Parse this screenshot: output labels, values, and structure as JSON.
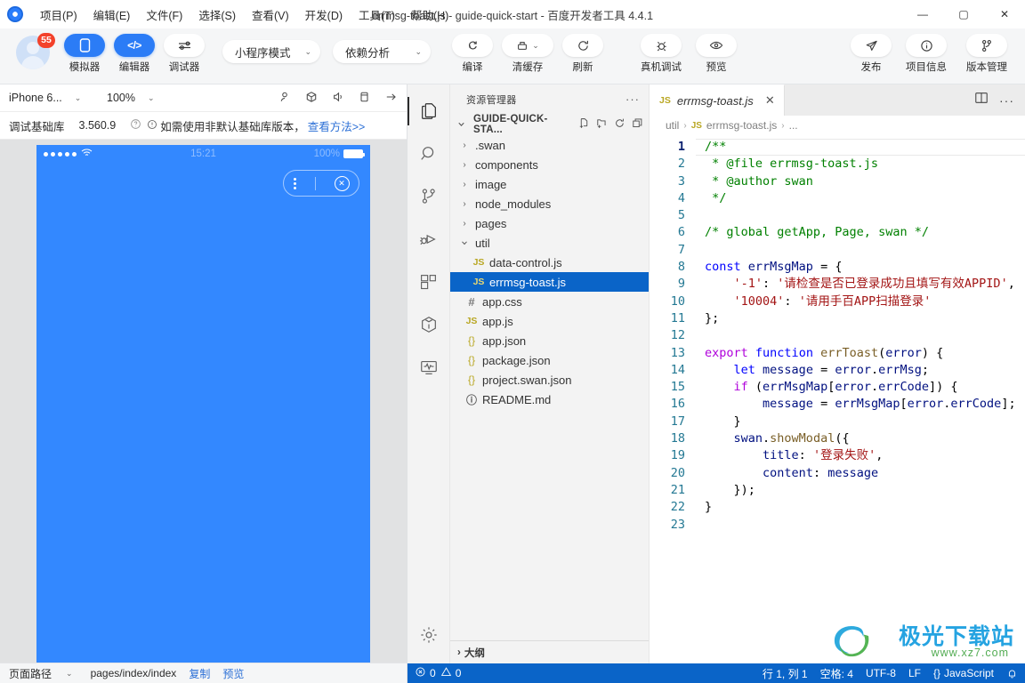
{
  "window": {
    "title": "errmsg-toast.js - guide-quick-start - 百度开发者工具 4.4.1",
    "minimize": "—",
    "maximize": "▢",
    "close": "✕"
  },
  "menubar": {
    "logo": "baidu-logo-icon",
    "items": [
      {
        "label": "项目(P)"
      },
      {
        "label": "编辑(E)"
      },
      {
        "label": "文件(F)"
      },
      {
        "label": "选择(S)"
      },
      {
        "label": "查看(V)"
      },
      {
        "label": "开发(D)"
      },
      {
        "label": "工具(T)"
      },
      {
        "label": "帮助(H)"
      }
    ]
  },
  "toolbar": {
    "avatar_badge": "55",
    "left_buttons": [
      {
        "label": "模拟器",
        "icon": "phone-icon",
        "glyph": "▯",
        "active": true
      },
      {
        "label": "编辑器",
        "icon": "code-icon",
        "glyph": "</>",
        "active": true
      },
      {
        "label": "调试器",
        "icon": "debug-slider-icon",
        "glyph": "⇌",
        "active": false
      }
    ],
    "mode_select": {
      "value": "小程序模式",
      "chevron": "⌄"
    },
    "analysis_select": {
      "value": "依赖分析",
      "chevron": "⌄"
    },
    "mid_buttons": [
      {
        "label": "编译",
        "icon": "compile-refresh-icon",
        "glyph": "↻"
      },
      {
        "label": "清缓存",
        "icon": "clear-cache-icon",
        "glyph": "⎙",
        "chevron": "⌄"
      },
      {
        "label": "刷新",
        "icon": "reload-icon",
        "glyph": "⟳"
      },
      {
        "label": "真机调试",
        "icon": "bug-device-icon",
        "glyph": "✸"
      },
      {
        "label": "预览",
        "icon": "eye-icon",
        "glyph": "◉"
      }
    ],
    "right_buttons": [
      {
        "label": "发布",
        "icon": "send-icon",
        "glyph": "➤"
      },
      {
        "label": "项目信息",
        "icon": "info-icon",
        "glyph": "ⓘ"
      },
      {
        "label": "版本管理",
        "icon": "branch-icon",
        "glyph": "⑂"
      }
    ]
  },
  "simulator": {
    "device": {
      "value": "iPhone 6...",
      "chevron": "⌄"
    },
    "zoom": {
      "value": "100%",
      "chevron": "⌄"
    },
    "right_icons": [
      {
        "name": "account-icon",
        "glyph": "⚲"
      },
      {
        "name": "cube-icon",
        "glyph": "⬡"
      },
      {
        "name": "volume-icon",
        "glyph": "◁"
      },
      {
        "name": "device-rotate-icon",
        "glyph": "▯"
      },
      {
        "name": "arrow-right-icon",
        "glyph": "→"
      }
    ],
    "baselib": {
      "label": "调试基础库",
      "version": "3.560.9",
      "help_icon": "question-circle-icon",
      "warn_icon": "exclamation-circle-icon",
      "notice": "如需使用非默认基础库版本，",
      "link": "查看方法>>"
    },
    "phone": {
      "signal_dots": 5,
      "wifi_icon": "wifi-icon",
      "time": "15:21",
      "battery_percent": "100%",
      "battery_icon": "battery-full-icon",
      "capsule": {
        "menu_icon": "kebab-menu-icon",
        "close_icon": "close-circle-icon"
      },
      "screen_color": "#3388ff"
    },
    "footer": {
      "path_label": "页面路径",
      "chevron": "⌄",
      "path_value": "pages/index/index",
      "copy": "复制",
      "preview": "预览"
    }
  },
  "activitybar": {
    "items": [
      {
        "name": "explorer-icon",
        "glyph": "🗐",
        "active": true
      },
      {
        "name": "search-icon",
        "glyph": "⌕",
        "active": false
      },
      {
        "name": "source-control-icon",
        "glyph": "⑂",
        "active": false
      },
      {
        "name": "run-debug-icon",
        "glyph": "▷",
        "active": false
      },
      {
        "name": "extensions-icon",
        "glyph": "⊞",
        "active": false
      },
      {
        "name": "package-icon",
        "glyph": "⬡",
        "active": false
      },
      {
        "name": "performance-icon",
        "glyph": "📈",
        "active": false
      }
    ],
    "bottom": {
      "name": "settings-gear-icon",
      "glyph": "⚙"
    }
  },
  "explorer": {
    "title": "资源管理器",
    "more": "···",
    "root": {
      "chevron": "⌄",
      "name": "GUIDE-QUICK-STA...",
      "actions": [
        {
          "name": "new-file-icon",
          "glyph": "🗋"
        },
        {
          "name": "new-folder-icon",
          "glyph": "🗀"
        },
        {
          "name": "refresh-icon",
          "glyph": "↻"
        },
        {
          "name": "collapse-all-icon",
          "glyph": "⊟"
        }
      ]
    },
    "tree": [
      {
        "label": ".swan",
        "type": "folder",
        "expanded": false,
        "depth": 1
      },
      {
        "label": "components",
        "type": "folder",
        "expanded": false,
        "depth": 1
      },
      {
        "label": "image",
        "type": "folder",
        "expanded": false,
        "depth": 1
      },
      {
        "label": "node_modules",
        "type": "folder",
        "expanded": false,
        "depth": 1
      },
      {
        "label": "pages",
        "type": "folder",
        "expanded": false,
        "depth": 1
      },
      {
        "label": "util",
        "type": "folder",
        "expanded": true,
        "depth": 1
      },
      {
        "label": "data-control.js",
        "type": "js",
        "depth": 2,
        "icon": "JS"
      },
      {
        "label": "errmsg-toast.js",
        "type": "js",
        "depth": 2,
        "icon": "JS",
        "selected": true
      },
      {
        "label": "app.css",
        "type": "css",
        "depth": 1,
        "icon": "#"
      },
      {
        "label": "app.js",
        "type": "js",
        "depth": 1,
        "icon": "JS"
      },
      {
        "label": "app.json",
        "type": "json",
        "depth": 1,
        "icon": "{}"
      },
      {
        "label": "package.json",
        "type": "json",
        "depth": 1,
        "icon": "{}"
      },
      {
        "label": "project.swan.json",
        "type": "json",
        "depth": 1,
        "icon": "{}"
      },
      {
        "label": "README.md",
        "type": "md",
        "depth": 1,
        "icon": "ⓘ"
      }
    ],
    "outline": {
      "chevron": "›",
      "label": "大纲"
    }
  },
  "editor": {
    "tab": {
      "icon": "JS",
      "name": "errmsg-toast.js",
      "close": "✕"
    },
    "tab_actions": [
      {
        "name": "split-editor-icon",
        "glyph": "▯▯"
      },
      {
        "name": "more-actions-icon",
        "glyph": "···"
      }
    ],
    "breadcrumb": [
      "util",
      "errmsg-toast.js",
      "..."
    ],
    "breadcrumb_icon": "JS",
    "code_lines": [
      {
        "n": 1,
        "tokens": [
          {
            "t": "/**",
            "c": "c-cmt"
          }
        ]
      },
      {
        "n": 2,
        "tokens": [
          {
            "t": " * @file errmsg-toast.js",
            "c": "c-cmt"
          }
        ]
      },
      {
        "n": 3,
        "tokens": [
          {
            "t": " * @author swan",
            "c": "c-cmt"
          }
        ]
      },
      {
        "n": 4,
        "tokens": [
          {
            "t": " */",
            "c": "c-cmt"
          }
        ]
      },
      {
        "n": 5,
        "tokens": []
      },
      {
        "n": 6,
        "tokens": [
          {
            "t": "/* global getApp, Page, swan */",
            "c": "c-cmt"
          }
        ]
      },
      {
        "n": 7,
        "tokens": []
      },
      {
        "n": 8,
        "tokens": [
          {
            "t": "const",
            "c": "c-kw"
          },
          {
            "t": " ",
            "c": "c-plain"
          },
          {
            "t": "errMsgMap",
            "c": "c-var"
          },
          {
            "t": " = {",
            "c": "c-plain"
          }
        ]
      },
      {
        "n": 9,
        "tokens": [
          {
            "t": "    ",
            "c": "c-plain"
          },
          {
            "t": "'-1'",
            "c": "c-str"
          },
          {
            "t": ": ",
            "c": "c-plain"
          },
          {
            "t": "'请检查是否已登录成功且填写有效APPID'",
            "c": "c-str"
          },
          {
            "t": ",",
            "c": "c-plain"
          }
        ]
      },
      {
        "n": 10,
        "tokens": [
          {
            "t": "    ",
            "c": "c-plain"
          },
          {
            "t": "'10004'",
            "c": "c-str"
          },
          {
            "t": ": ",
            "c": "c-plain"
          },
          {
            "t": "'请用手百APP扫描登录'",
            "c": "c-str"
          }
        ]
      },
      {
        "n": 11,
        "tokens": [
          {
            "t": "};",
            "c": "c-plain"
          }
        ]
      },
      {
        "n": 12,
        "tokens": []
      },
      {
        "n": 13,
        "tokens": [
          {
            "t": "export",
            "c": "c-kw2"
          },
          {
            "t": " ",
            "c": "c-plain"
          },
          {
            "t": "function",
            "c": "c-kw"
          },
          {
            "t": " ",
            "c": "c-plain"
          },
          {
            "t": "errToast",
            "c": "c-fn"
          },
          {
            "t": "(",
            "c": "c-plain"
          },
          {
            "t": "error",
            "c": "c-var"
          },
          {
            "t": ") {",
            "c": "c-plain"
          }
        ]
      },
      {
        "n": 14,
        "tokens": [
          {
            "t": "    ",
            "c": "c-plain"
          },
          {
            "t": "let",
            "c": "c-kw"
          },
          {
            "t": " ",
            "c": "c-plain"
          },
          {
            "t": "message",
            "c": "c-var"
          },
          {
            "t": " = ",
            "c": "c-plain"
          },
          {
            "t": "error",
            "c": "c-var"
          },
          {
            "t": ".",
            "c": "c-plain"
          },
          {
            "t": "errMsg",
            "c": "c-var"
          },
          {
            "t": ";",
            "c": "c-plain"
          }
        ]
      },
      {
        "n": 15,
        "tokens": [
          {
            "t": "    ",
            "c": "c-plain"
          },
          {
            "t": "if",
            "c": "c-kw2"
          },
          {
            "t": " (",
            "c": "c-plain"
          },
          {
            "t": "errMsgMap",
            "c": "c-var"
          },
          {
            "t": "[",
            "c": "c-plain"
          },
          {
            "t": "error",
            "c": "c-var"
          },
          {
            "t": ".",
            "c": "c-plain"
          },
          {
            "t": "errCode",
            "c": "c-var"
          },
          {
            "t": "]) {",
            "c": "c-plain"
          }
        ]
      },
      {
        "n": 16,
        "tokens": [
          {
            "t": "        ",
            "c": "c-plain"
          },
          {
            "t": "message",
            "c": "c-var"
          },
          {
            "t": " = ",
            "c": "c-plain"
          },
          {
            "t": "errMsgMap",
            "c": "c-var"
          },
          {
            "t": "[",
            "c": "c-plain"
          },
          {
            "t": "error",
            "c": "c-var"
          },
          {
            "t": ".",
            "c": "c-plain"
          },
          {
            "t": "errCode",
            "c": "c-var"
          },
          {
            "t": "];",
            "c": "c-plain"
          }
        ]
      },
      {
        "n": 17,
        "tokens": [
          {
            "t": "    }",
            "c": "c-plain"
          }
        ]
      },
      {
        "n": 18,
        "tokens": [
          {
            "t": "    ",
            "c": "c-plain"
          },
          {
            "t": "swan",
            "c": "c-var"
          },
          {
            "t": ".",
            "c": "c-plain"
          },
          {
            "t": "showModal",
            "c": "c-fn"
          },
          {
            "t": "({",
            "c": "c-plain"
          }
        ]
      },
      {
        "n": 19,
        "tokens": [
          {
            "t": "        ",
            "c": "c-plain"
          },
          {
            "t": "title",
            "c": "c-var"
          },
          {
            "t": ": ",
            "c": "c-plain"
          },
          {
            "t": "'登录失败'",
            "c": "c-str"
          },
          {
            "t": ",",
            "c": "c-plain"
          }
        ]
      },
      {
        "n": 20,
        "tokens": [
          {
            "t": "        ",
            "c": "c-plain"
          },
          {
            "t": "content",
            "c": "c-var"
          },
          {
            "t": ": ",
            "c": "c-plain"
          },
          {
            "t": "message",
            "c": "c-var"
          }
        ]
      },
      {
        "n": 21,
        "tokens": [
          {
            "t": "    });",
            "c": "c-plain"
          }
        ]
      },
      {
        "n": 22,
        "tokens": [
          {
            "t": "}",
            "c": "c-plain"
          }
        ]
      },
      {
        "n": 23,
        "tokens": []
      }
    ]
  },
  "statusbar": {
    "errors": {
      "icon": "error-circle-icon",
      "count": "0"
    },
    "warnings": {
      "icon": "warning-triangle-icon",
      "count": "0"
    },
    "cursor": "行 1, 列 1",
    "indent": "空格: 4",
    "encoding": "UTF-8",
    "eol": "LF",
    "language": "JavaScript",
    "language_icon": "{}",
    "bell": "🔔"
  },
  "watermark": {
    "title": "极光下载站",
    "url": "www.xz7.com"
  }
}
